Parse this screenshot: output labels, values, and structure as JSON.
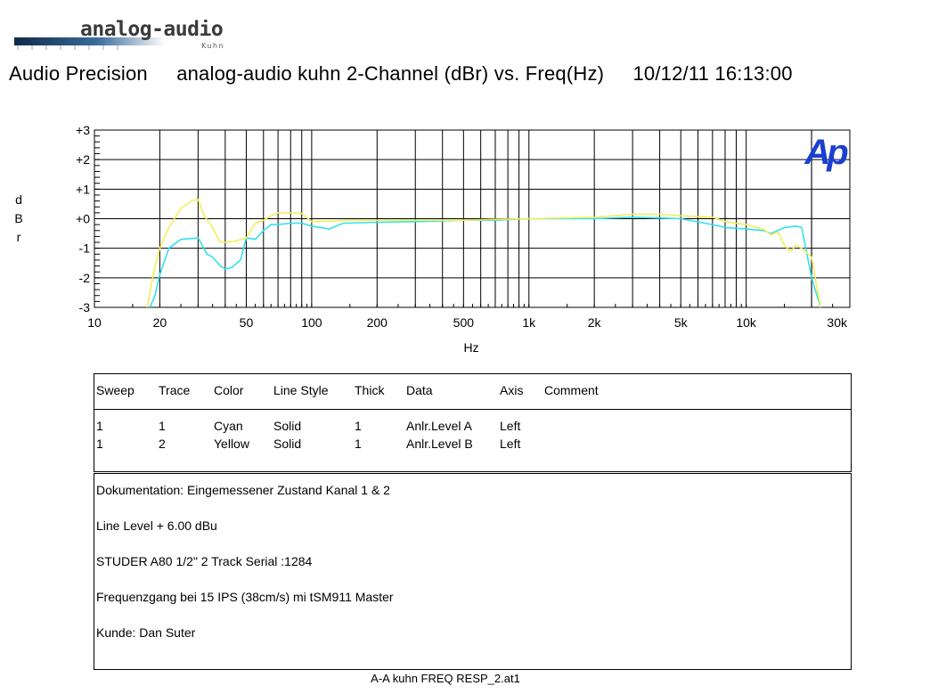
{
  "logo": {
    "name": "analog-audio",
    "sub": "Kuhn"
  },
  "header": {
    "app": "Audio Precision",
    "description": "analog-audio kuhn  2-Channel (dBr) vs. Freq(Hz)",
    "datetime": "10/12/11 16:13:00"
  },
  "chart_data": {
    "type": "line",
    "xscale": "log",
    "xlim": [
      10,
      30000
    ],
    "ylim": [
      -3,
      3
    ],
    "xlabel": "Hz",
    "ylabel": "dBr",
    "ylabel_chars": [
      "d",
      "B",
      "r"
    ],
    "x_ticks": [
      {
        "v": 10,
        "label": "10"
      },
      {
        "v": 20,
        "label": "20"
      },
      {
        "v": 50,
        "label": "50"
      },
      {
        "v": 100,
        "label": "100"
      },
      {
        "v": 200,
        "label": "200"
      },
      {
        "v": 500,
        "label": "500"
      },
      {
        "v": 1000,
        "label": "1k"
      },
      {
        "v": 2000,
        "label": "2k"
      },
      {
        "v": 5000,
        "label": "5k"
      },
      {
        "v": 10000,
        "label": "10k"
      },
      {
        "v": 30000,
        "label": "30k"
      }
    ],
    "y_ticks": [
      {
        "v": 3,
        "label": "+3"
      },
      {
        "v": 2,
        "label": "+2"
      },
      {
        "v": 1,
        "label": "+1"
      },
      {
        "v": 0,
        "label": "+0"
      },
      {
        "v": -1,
        "label": "-1"
      },
      {
        "v": -2,
        "label": "-2"
      },
      {
        "v": -3,
        "label": "-3"
      }
    ],
    "grid": true,
    "badge": "Ap",
    "badge_color": "#1b3fd0",
    "series": [
      {
        "color": "#33e0f0",
        "x": [
          18,
          19,
          20,
          22,
          25,
          30,
          33,
          35,
          38,
          40,
          43,
          47,
          50,
          55,
          60,
          65,
          70,
          80,
          90,
          100,
          120,
          140,
          200,
          300,
          500,
          700,
          1000,
          2000,
          3000,
          5000,
          7000,
          8000,
          10000,
          12000,
          13000,
          15000,
          17000,
          18000,
          20000,
          22000
        ],
        "y": [
          -3.0,
          -2.6,
          -1.9,
          -1.0,
          -0.7,
          -0.65,
          -1.2,
          -1.3,
          -1.6,
          -1.7,
          -1.65,
          -1.4,
          -0.65,
          -0.7,
          -0.4,
          -0.2,
          -0.2,
          -0.15,
          -0.15,
          -0.25,
          -0.35,
          -0.15,
          -0.12,
          -0.1,
          -0.05,
          -0.05,
          0.0,
          0.0,
          0.05,
          0.0,
          -0.2,
          -0.3,
          -0.35,
          -0.4,
          -0.5,
          -0.3,
          -0.25,
          -0.3,
          -2.0,
          -3.0
        ]
      },
      {
        "color": "#f2ef5a",
        "x": [
          17.5,
          18,
          19,
          20,
          22,
          25,
          28,
          30,
          32,
          35,
          38,
          40,
          45,
          50,
          55,
          60,
          65,
          70,
          80,
          90,
          100,
          120,
          150,
          200,
          300,
          500,
          700,
          1000,
          2000,
          3000,
          4000,
          5000,
          7000,
          8000,
          10000,
          12000,
          13000,
          14000,
          15000,
          16000,
          17000,
          18000,
          20000,
          22000
        ],
        "y": [
          -3.0,
          -2.5,
          -1.6,
          -1.0,
          -0.3,
          0.35,
          0.6,
          0.65,
          0.1,
          -0.3,
          -0.8,
          -0.8,
          -0.75,
          -0.65,
          -0.15,
          -0.05,
          0.1,
          0.2,
          0.2,
          0.18,
          -0.1,
          -0.08,
          -0.05,
          -0.05,
          -0.05,
          -0.05,
          -0.02,
          0.0,
          0.05,
          0.15,
          0.15,
          0.1,
          0.05,
          -0.1,
          -0.2,
          -0.35,
          -0.55,
          -0.45,
          -0.9,
          -1.1,
          -0.9,
          -1.0,
          -1.3,
          -3.0
        ]
      }
    ]
  },
  "legend": {
    "headers": [
      "Sweep",
      "Trace",
      "Color",
      "Line Style",
      "Thick",
      "Data",
      "Axis",
      "Comment"
    ],
    "rows": [
      [
        "1",
        "1",
        "Cyan",
        "Solid",
        "1",
        "Anlr.Level A",
        "Left",
        ""
      ],
      [
        "1",
        "2",
        "Yellow",
        "Solid",
        "1",
        "Anlr.Level B",
        "Left",
        ""
      ]
    ]
  },
  "notes": [
    "Dokumentation: Eingemessener Zustand Kanal 1 & 2",
    "Line Level + 6.00 dBu",
    "STUDER A80 1/2\"  2 Track Serial :1284",
    "Frequenzgang bei 15  IPS (38cm/s) mi tSM911 Master",
    "Kunde: Dan Suter"
  ],
  "footer": "A-A kuhn FREQ RESP_2.at1"
}
